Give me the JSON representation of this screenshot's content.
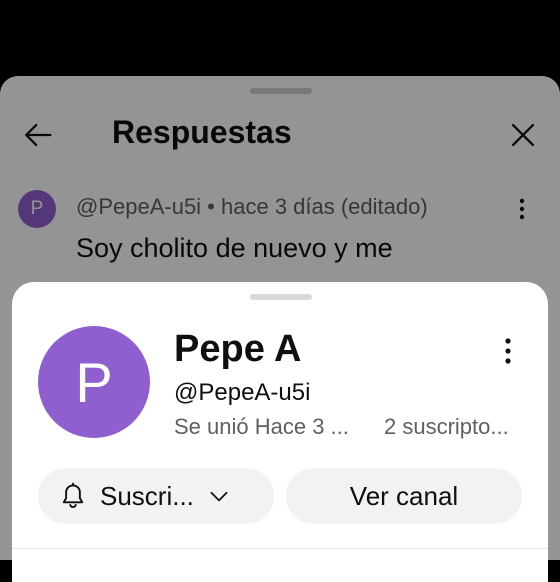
{
  "replies_panel": {
    "title": "Respuestas",
    "comment": {
      "avatar_letter": "P",
      "meta": "@PepeA-u5i • hace 3 días (editado)",
      "text": "Soy cholito de nuevo y me"
    }
  },
  "profile_sheet": {
    "avatar_letter": "P",
    "name": "Pepe A",
    "handle": "@PepeA-u5i",
    "joined": "Se unió Hace 3 ...",
    "subscribers": "2 suscripto...",
    "subscribe_label": "Suscri...",
    "view_channel_label": "Ver canal"
  },
  "colors": {
    "avatar": "#8f5fd0",
    "button_bg": "#f2f2f2",
    "text_primary": "#0f0f0f",
    "text_secondary": "#606060"
  },
  "icons": [
    "arrow-back-icon",
    "close-icon",
    "more-vert-icon",
    "bell-icon",
    "chevron-down-icon"
  ]
}
